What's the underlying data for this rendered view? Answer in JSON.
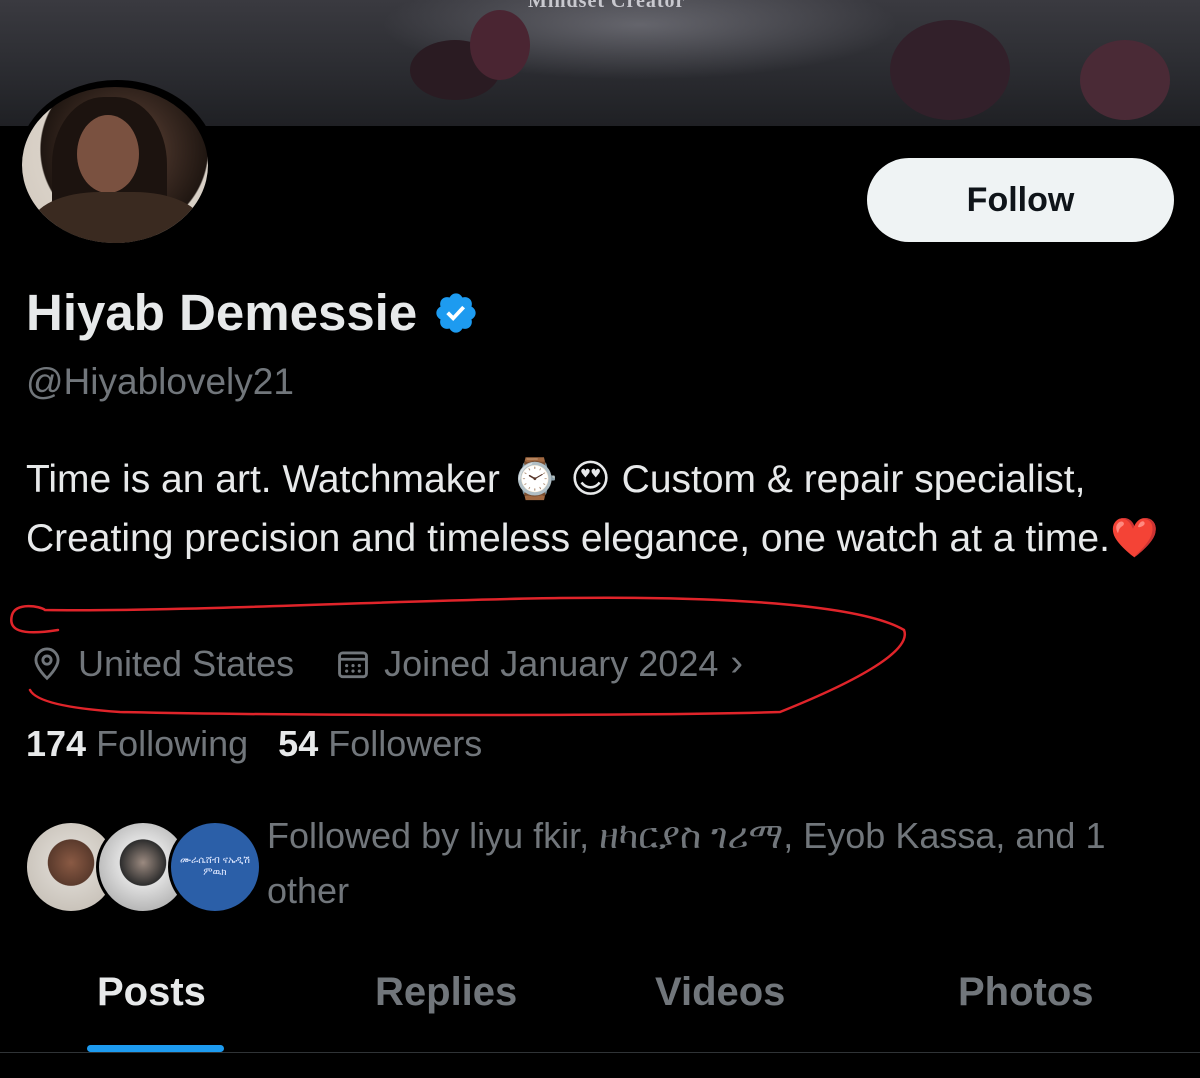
{
  "banner": {
    "text": "Mindset Creator"
  },
  "profile": {
    "display_name": "Hiyab Demessie",
    "handle": "@Hiyablovely21",
    "verified": true,
    "follow_label": "Follow",
    "bio": {
      "part1": "Time is an art. Watchmaker ",
      "emoji_watch": "⌚",
      "emoji_heart_eyes": "😍",
      "part2": " Custom & repair specialist, Creating precision and timeless elegance, one watch at a time.",
      "emoji_heart": "❤️"
    },
    "location": "United States",
    "joined": "Joined January 2024",
    "following_count": "174",
    "following_label": "Following",
    "followers_count": "54",
    "followers_label": "Followers",
    "followed_by": "Followed by liyu fkir, ዘካርያስ ገሪማ, Eyob Kassa, and 1 other",
    "mini_avatar_text": "ሙራሴሸብ ናኤዲሽ ምዉክ"
  },
  "tabs": [
    {
      "label": "Posts",
      "active": true
    },
    {
      "label": "Replies",
      "active": false
    },
    {
      "label": "Videos",
      "active": false
    },
    {
      "label": "Photos",
      "active": false
    }
  ],
  "colors": {
    "background": "#000000",
    "accent": "#1d9bf0",
    "verified": "#1d9bf0",
    "muted_text": "#71767b",
    "annotation": "#e0242a"
  },
  "icons": [
    "location-pin-icon",
    "calendar-icon",
    "chevron-right-icon",
    "verified-badge-icon"
  ]
}
